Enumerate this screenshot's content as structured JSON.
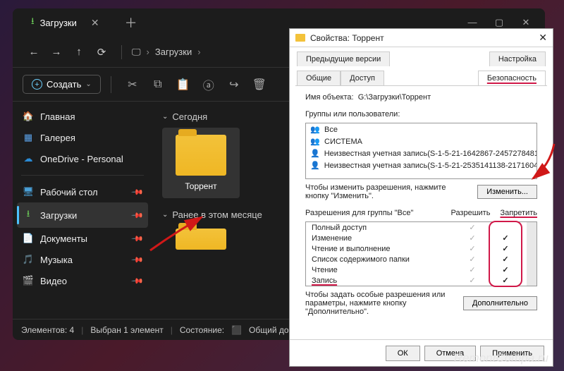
{
  "explorer": {
    "tab_title": "Загрузки",
    "nav_crumb": "Загрузки",
    "toolbar": {
      "create": "Создать"
    },
    "sidebar": {
      "home": "Главная",
      "gallery": "Галерея",
      "onedrive": "OneDrive - Personal",
      "desktop": "Рабочий стол",
      "downloads": "Загрузки",
      "documents": "Документы",
      "music": "Музыка",
      "videos": "Видео"
    },
    "groups": {
      "today": "Сегодня",
      "earlier": "Ранее в этом месяце"
    },
    "folder_selected": "Торрент",
    "status": {
      "count": "Элементов: 4",
      "selected": "Выбран 1 элемент",
      "state_label": "Состояние:",
      "state_value": "Общий доступ"
    }
  },
  "props": {
    "title": "Свойства: Торрент",
    "tabs": {
      "prev": "Предыдущие версии",
      "settings": "Настройка",
      "general": "Общие",
      "sharing": "Доступ",
      "security": "Безопасность"
    },
    "object_label": "Имя объекта:",
    "object_value": "G:\\Загрузки\\Торрент",
    "groups_label": "Группы или пользователи:",
    "groups": [
      "Все",
      "СИСТЕМА",
      "Неизвестная учетная запись(S-1-5-21-1642867-2457278481-",
      "Неизвестная учетная запись(S-1-5-21-2535141138-2171604"
    ],
    "edit_hint": "Чтобы изменить разрешения, нажмите кнопку \"Изменить\".",
    "edit_btn": "Изменить...",
    "perms_for": "Разрешения для группы \"Все\"",
    "allow_col": "Разрешить",
    "deny_col": "Запретить",
    "perms": [
      {
        "label": "Полный доступ",
        "allow": true,
        "deny": false
      },
      {
        "label": "Изменение",
        "allow": true,
        "deny": true
      },
      {
        "label": "Чтение и выполнение",
        "allow": true,
        "deny": true
      },
      {
        "label": "Список содержимого папки",
        "allow": true,
        "deny": true
      },
      {
        "label": "Чтение",
        "allow": true,
        "deny": true
      },
      {
        "label": "Запись",
        "allow": true,
        "deny": true,
        "hu": true
      }
    ],
    "adv_hint": "Чтобы задать особые разрешения или параметры, нажмите кнопку \"Дополнительно\".",
    "adv_btn": "Дополнительно",
    "footer": {
      "ok": "ОК",
      "cancel": "Отмена",
      "apply": "Применить"
    }
  },
  "watermark": "RemontCompa.ru"
}
